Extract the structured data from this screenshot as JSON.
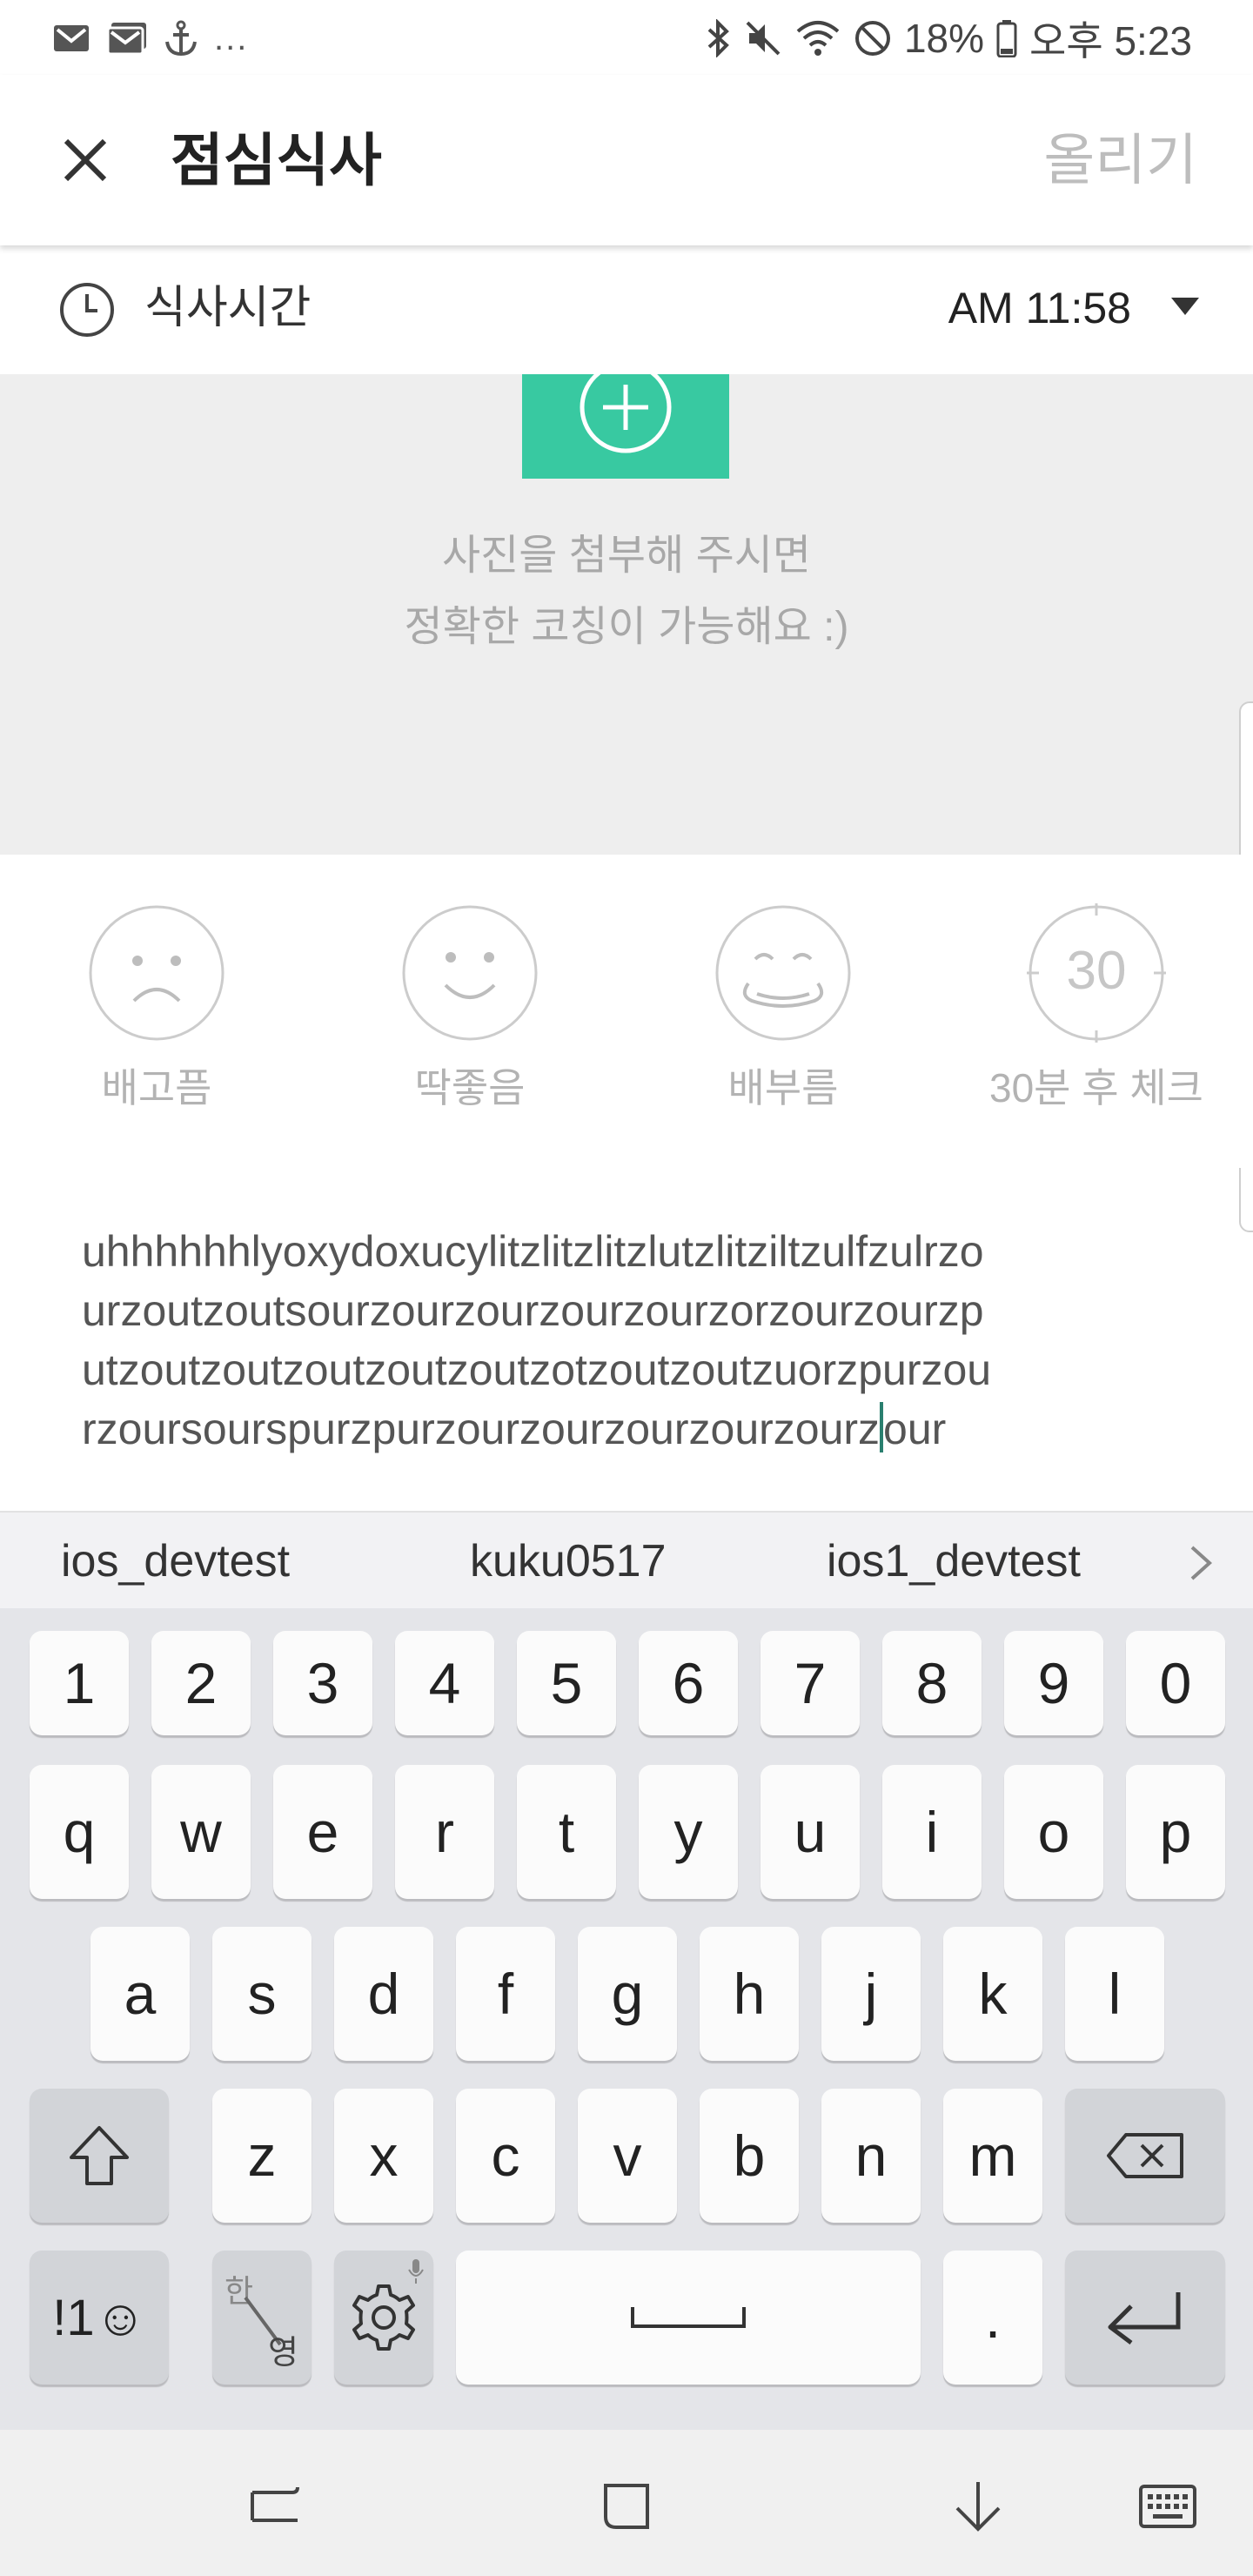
{
  "status_bar": {
    "left_icons": [
      "gmail-icon",
      "gmail-icon",
      "anchor-icon"
    ],
    "overflow": "...",
    "battery": "18%",
    "time": "오후 5:23"
  },
  "app_bar": {
    "title": "점심식사",
    "post_label": "올리기"
  },
  "meal_time": {
    "label": "식사시간",
    "value": "AM 11:58"
  },
  "photo": {
    "hint_line1": "사진을 첨부해 주시면",
    "hint_line2": "정확한 코칭이 가능해요 :)",
    "accent_color": "#38c9a1"
  },
  "feelings": [
    {
      "label": "배고픔",
      "icon": "sad-face-icon"
    },
    {
      "label": "딱좋음",
      "icon": "smile-face-icon"
    },
    {
      "label": "배부름",
      "icon": "full-face-icon"
    },
    {
      "label": "30분 후 체크",
      "icon": "timer-30-icon",
      "icon_text": "30"
    }
  ],
  "memo": {
    "lines": [
      "uhhhhhhlyoxydoxucylitzlitzlitzlutzlitziltzulfzulrzo",
      "urzoutzoutsourzourzourzourzourzorzourzourzp",
      "utzoutzoutzoutzoutzoutzotzoutzoutzuorzpurzou",
      "rzoursourspurzpurzourzourzourzourzourz"
    ],
    "after_caret": "our"
  },
  "suggestions": [
    "ios_devtest",
    "kuku0517",
    "ios1_devtest"
  ],
  "keyboard": {
    "row_numbers": [
      "1",
      "2",
      "3",
      "4",
      "5",
      "6",
      "7",
      "8",
      "9",
      "0"
    ],
    "row1": [
      "q",
      "w",
      "e",
      "r",
      "t",
      "y",
      "u",
      "i",
      "o",
      "p"
    ],
    "row2": [
      "a",
      "s",
      "d",
      "f",
      "g",
      "h",
      "j",
      "k",
      "l"
    ],
    "row3": [
      "z",
      "x",
      "c",
      "v",
      "b",
      "n",
      "m"
    ],
    "symbols_label": "!1☺",
    "lang_top": "한",
    "lang_bottom": "영",
    "period": "."
  }
}
